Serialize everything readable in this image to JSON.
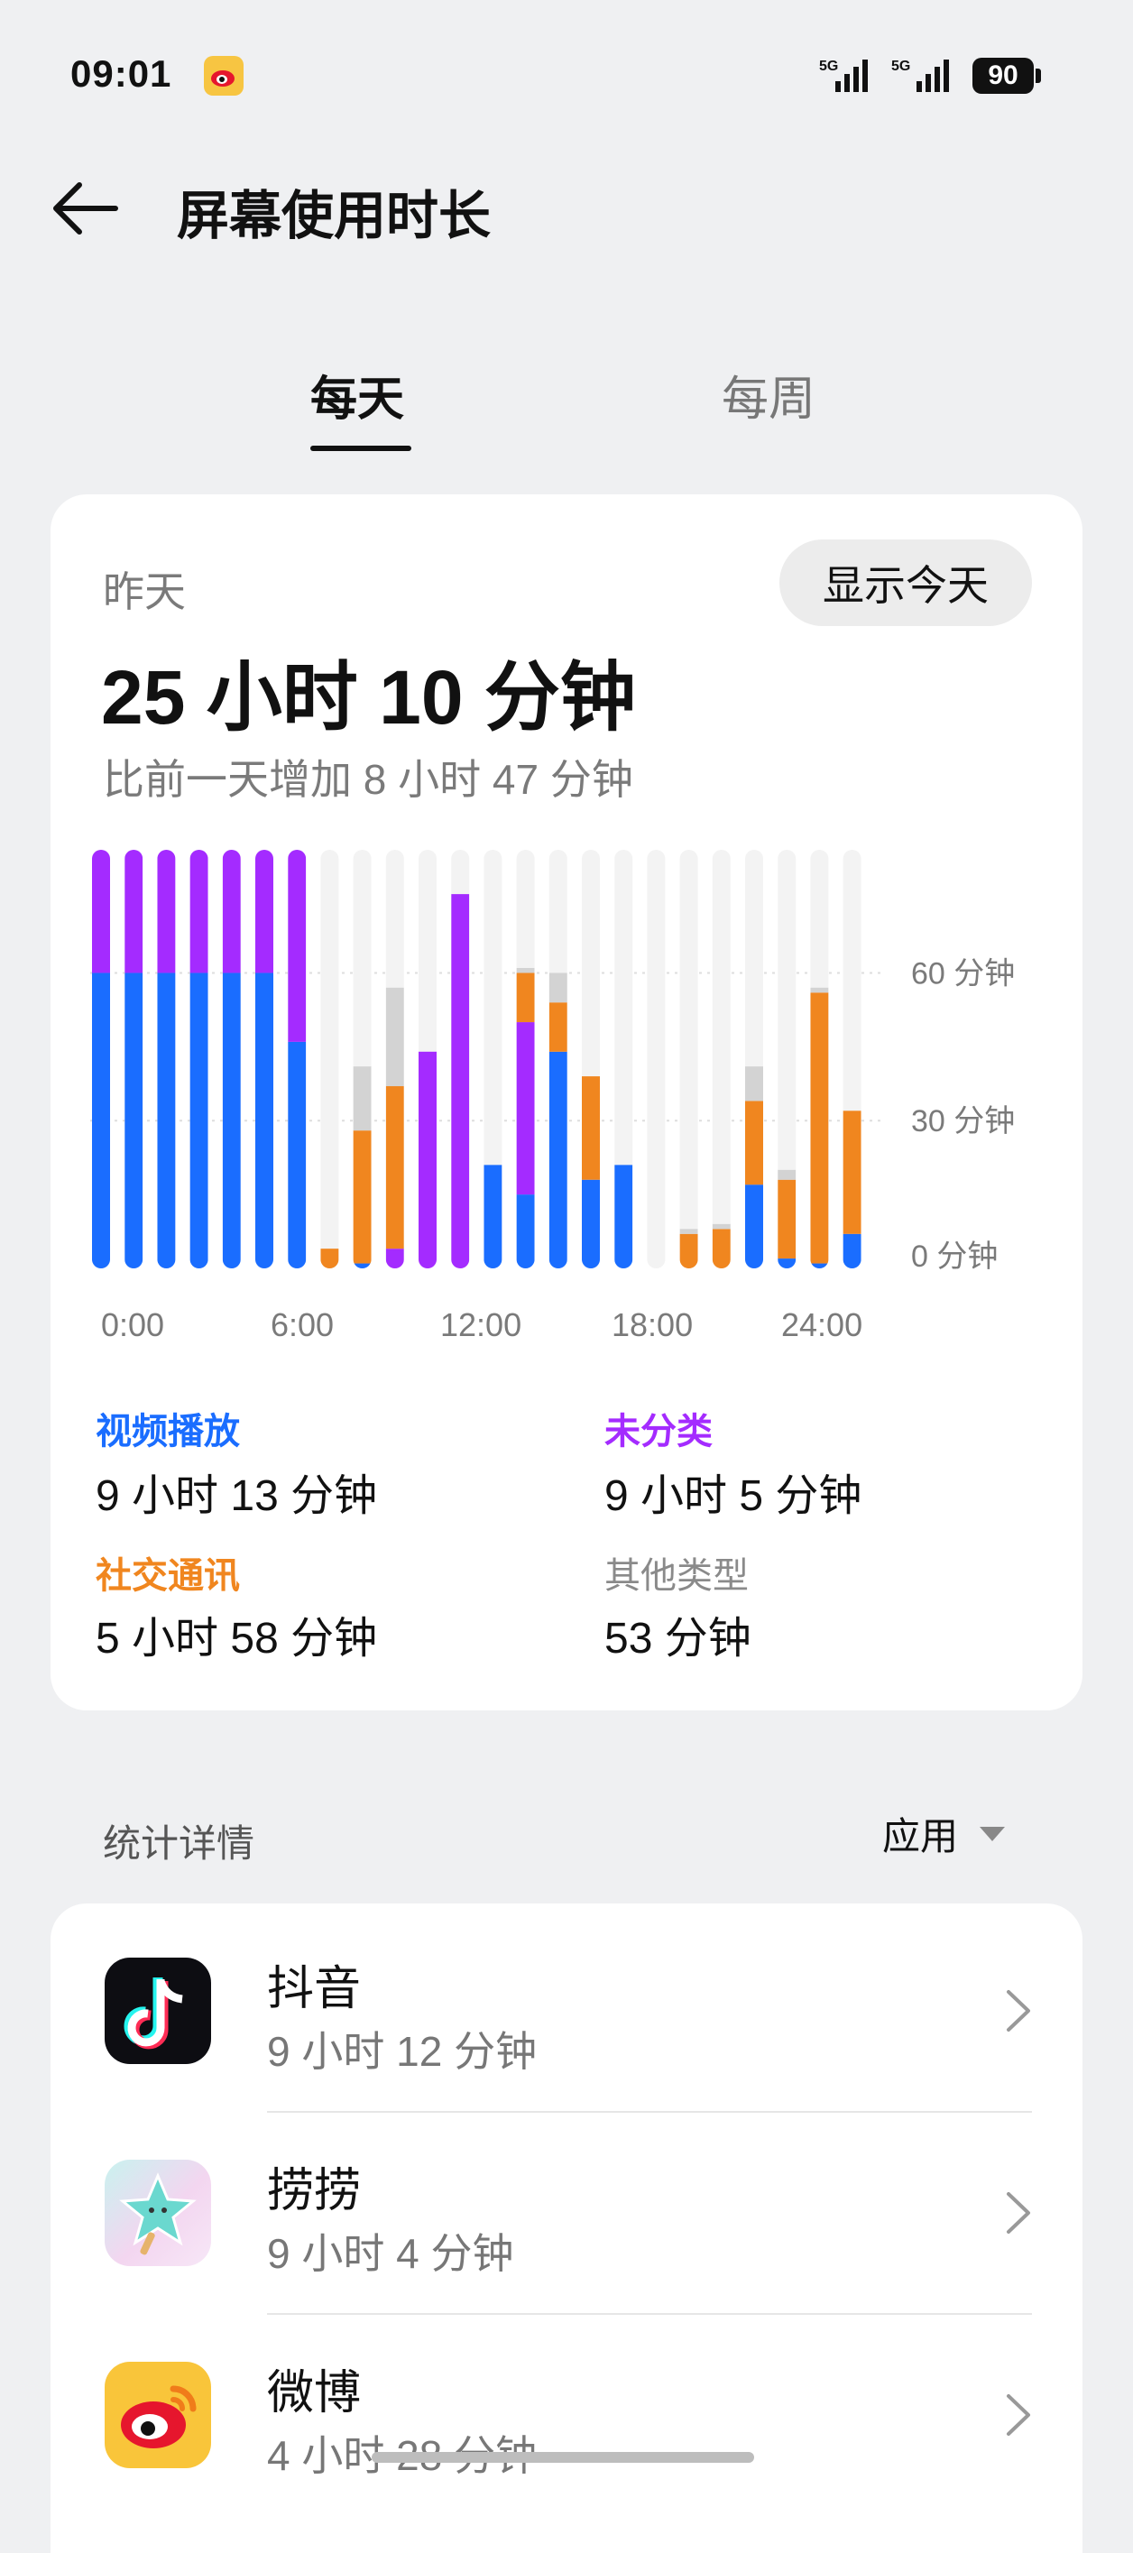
{
  "status": {
    "time": "09:01",
    "signal1": "5G",
    "signal2": "5G",
    "battery": "90"
  },
  "header": {
    "title": "屏幕使用时长"
  },
  "tabs": [
    {
      "label": "每天",
      "active": true
    },
    {
      "label": "每周",
      "active": false
    }
  ],
  "summary": {
    "day_label": "昨天",
    "show_today_label": "显示今天",
    "total": "25 小时 10 分钟",
    "compare": "比前一天增加 8 小时 47 分钟"
  },
  "chart_data": {
    "type": "bar",
    "stacked": true,
    "categories": [
      "0",
      "1",
      "2",
      "3",
      "4",
      "5",
      "6",
      "7",
      "8",
      "9",
      "10",
      "11",
      "12",
      "13",
      "14",
      "15",
      "16",
      "17",
      "18",
      "19",
      "20",
      "21",
      "22",
      "23"
    ],
    "series": [
      {
        "name": "视频播放",
        "color": "#1a6dff",
        "values": [
          60,
          60,
          60,
          60,
          60,
          60,
          46,
          0,
          1,
          0,
          0,
          0,
          21,
          15,
          44,
          18,
          21,
          0,
          0,
          0,
          17,
          2,
          1,
          7
        ]
      },
      {
        "name": "未分类",
        "color": "#a42bff",
        "values": [
          25,
          25,
          25,
          25,
          25,
          25,
          39,
          0,
          0,
          4,
          44,
          76,
          0,
          35,
          0,
          0,
          0,
          0,
          0,
          0,
          0,
          0,
          0,
          0
        ]
      },
      {
        "name": "社交通讯",
        "color": "#f0861f",
        "values": [
          0,
          0,
          0,
          0,
          0,
          0,
          0,
          4,
          27,
          33,
          0,
          0,
          0,
          10,
          10,
          21,
          0,
          0,
          7,
          8,
          17,
          16,
          55,
          25
        ]
      },
      {
        "name": "其他类型",
        "color": "#d3d3d3",
        "values": [
          0,
          0,
          0,
          0,
          0,
          0,
          0,
          0,
          13,
          20,
          0,
          0,
          0,
          1,
          6,
          0,
          0,
          0,
          1,
          1,
          7,
          2,
          1,
          0
        ]
      }
    ],
    "x_tick_labels": [
      "0:00",
      "6:00",
      "12:00",
      "18:00",
      "24:00"
    ],
    "y_tick_labels": [
      "0 分钟",
      "30 分钟",
      "60 分钟"
    ],
    "ylim": [
      0,
      85
    ]
  },
  "categories": [
    {
      "label": "视频播放",
      "value": "9 小时 13 分钟",
      "color": "#1a6dff"
    },
    {
      "label": "未分类",
      "value": "9 小时 5 分钟",
      "color": "#a42bff"
    },
    {
      "label": "社交通讯",
      "value": "5 小时 58 分钟",
      "color": "#f0861f"
    },
    {
      "label": "其他类型",
      "value": "53 分钟",
      "color": "#8a8a8a"
    }
  ],
  "details": {
    "title": "统计详情",
    "sort_label": "应用"
  },
  "apps": [
    {
      "name": "抖音",
      "time": "9 小时 12 分钟",
      "icon": "douyin-icon"
    },
    {
      "name": "捞捞",
      "time": "9 小时 4 分钟",
      "icon": "laolao-icon"
    },
    {
      "name": "微博",
      "time": "4 小时 28 分钟",
      "icon": "weibo-icon"
    }
  ]
}
